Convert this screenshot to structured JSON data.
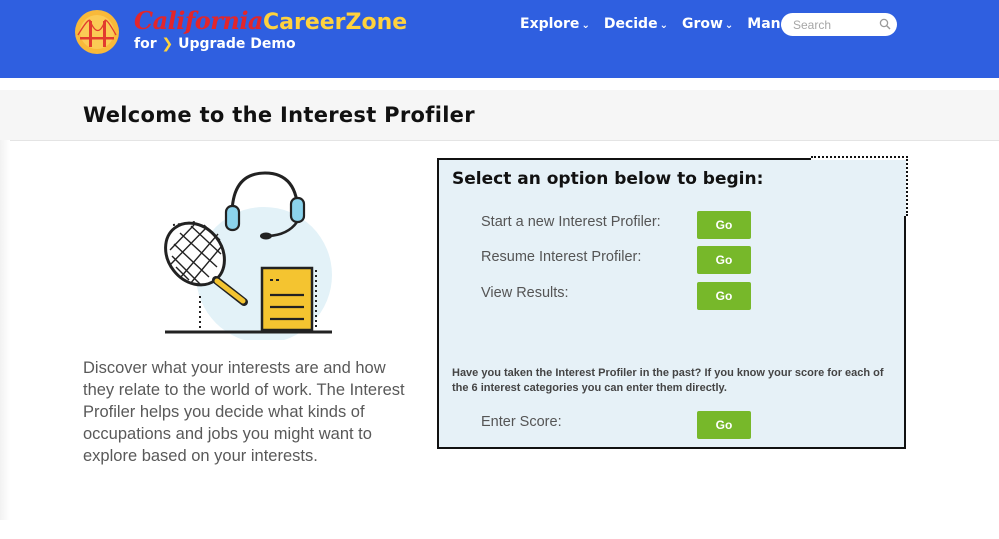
{
  "header": {
    "brand_script": "California",
    "brand_name": "CareerZone",
    "brand_for": "for",
    "brand_arrow": "❯",
    "brand_org": "Upgrade Demo",
    "nav": [
      {
        "label": "Explore",
        "icon": "chevron-down-icon"
      },
      {
        "label": "Decide",
        "icon": "chevron-down-icon"
      },
      {
        "label": "Grow",
        "icon": "chevron-down-icon"
      },
      {
        "label": "Manage",
        "icon": "chevron-down-icon"
      }
    ],
    "search_placeholder": "Search",
    "colors": {
      "bar": "#2f5fe0",
      "accent": "#ffd23d",
      "script": "#e2262b"
    }
  },
  "page": {
    "title": "Welcome to the Interest Profiler",
    "intro": "Discover what your interests are and how they relate to the world of work. The Interest Profiler helps you decide what kinds of occupations and jobs you might want to explore based on your interests."
  },
  "panel": {
    "heading": "Select an option below to begin:",
    "options": [
      {
        "label": "Start a new Interest Profiler:",
        "button": "Go"
      },
      {
        "label": "Resume Interest Profiler:",
        "button": "Go"
      },
      {
        "label": "View Results:",
        "button": "Go"
      }
    ],
    "past_note": "Have you taken the Interest Profiler in the past? If you know your score for each of the 6 interest categories you can enter them directly.",
    "score": {
      "label": "Enter Score:",
      "button": "Go"
    },
    "colors": {
      "background": "#e6f1f7",
      "go_button": "#77b82a"
    }
  }
}
